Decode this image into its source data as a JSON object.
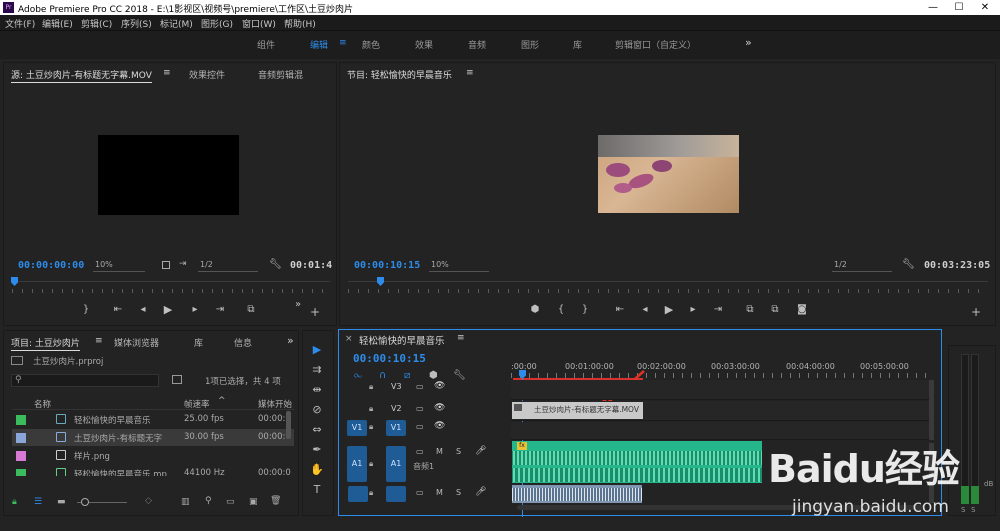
{
  "window": {
    "title": "Adobe Premiere Pro CC 2018 - E:\\1影视区\\视频号\\premiere\\工作区\\土豆炒肉片",
    "app_icon": "Pr",
    "minimize": "—",
    "maximize": "☐",
    "close": "✕"
  },
  "menu": [
    "文件(F)",
    "编辑(E)",
    "剪辑(C)",
    "序列(S)",
    "标记(M)",
    "图形(G)",
    "窗口(W)",
    "帮助(H)"
  ],
  "workspaces": {
    "items": [
      "组件",
      "编辑",
      "颜色",
      "效果",
      "音频",
      "图形",
      "库",
      "剪辑窗口（自定义）"
    ],
    "active": "编辑",
    "menu_icon": "≡",
    "more": "»"
  },
  "source_monitor": {
    "tabs": [
      "源: 土豆炒肉片-有标题无字幕.MOV",
      "效果控件",
      "音频剪辑混"
    ],
    "menu_icon": "≡",
    "timecode": "00:00:00:00",
    "zoom": "10%",
    "resolution": "1/2",
    "duration": "00:01:4",
    "more": "»",
    "add": "+"
  },
  "program_monitor": {
    "title": "节目: 轻松愉快的早晨音乐",
    "menu_icon": "≡",
    "timecode": "00:00:10:15",
    "zoom": "10%",
    "resolution": "1/2",
    "duration": "00:03:23:05",
    "add": "+"
  },
  "project": {
    "tabs": [
      "项目: 土豆炒肉片",
      "媒体浏览器",
      "库",
      "信息"
    ],
    "more": "»",
    "file": "土豆炒肉片.prproj",
    "selection_info": "1项已选择，共 4 项",
    "columns": [
      "名称",
      "帧速率",
      "媒体开始"
    ],
    "rows": [
      {
        "name": "轻松愉快的早晨音乐",
        "fps": "25.00 fps",
        "start": "00:00:0",
        "color": "#3bba5e"
      },
      {
        "name": "土豆炒肉片-有标题无字",
        "fps": "30.00 fps",
        "start": "00:00:0",
        "color": "#8aa6d8"
      },
      {
        "name": "样片.png",
        "fps": "",
        "start": "",
        "color": "#d67ad6"
      },
      {
        "name": "轻松愉快的早晨音乐.mp",
        "fps": "44100 Hz",
        "start": "00:00:0",
        "color": "#3bba5e"
      }
    ]
  },
  "timeline": {
    "title": "轻松愉快的早晨音乐",
    "close": "×",
    "menu_icon": "≡",
    "timecode": "00:00:10:15",
    "ruler": [
      ":00:00",
      "00:01:00:00",
      "00:02:00:00",
      "00:03:00:00",
      "00:04:00:00",
      "00:05:00:00"
    ],
    "tracks": {
      "v3": "V3",
      "v2": "V2",
      "v1_src": "V1",
      "v1": "V1",
      "a1_src": "A1",
      "a1": "A1",
      "a1_name": "音频1",
      "m": "M",
      "s": "S"
    },
    "clip_v2": "土豆炒肉片-有标题无字幕.MOV",
    "clip_marker": "fx"
  },
  "meter": {
    "db": "dB",
    "s": "S"
  },
  "watermark": {
    "text": "Baidu经验",
    "url": "jingyan.baidu.com"
  },
  "colors": {
    "accent": "#2d8ceb",
    "audio_clip": "#25b68c",
    "work_area": "#d8312f",
    "arrow": "#e03226"
  }
}
